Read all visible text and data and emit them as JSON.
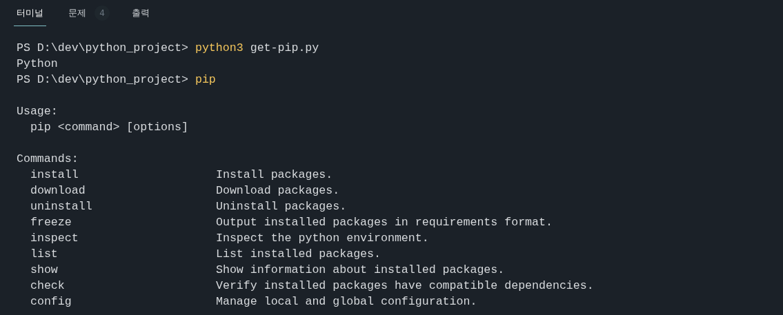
{
  "tabs": [
    {
      "label": "터미널",
      "selected": true
    },
    {
      "label": "문제",
      "selected": false,
      "badge": "4"
    },
    {
      "label": "출력",
      "selected": false
    }
  ],
  "terminal": {
    "lines": [
      {
        "kind": "prompt",
        "prompt": "PS D:\\dev\\python_project>",
        "command": "python3",
        "args": "get-pip.py"
      },
      {
        "kind": "output",
        "text": "Python"
      },
      {
        "kind": "prompt",
        "prompt": "PS D:\\dev\\python_project>",
        "command": "pip"
      },
      {
        "kind": "blank"
      },
      {
        "kind": "output",
        "text": "Usage:"
      },
      {
        "kind": "output",
        "text": "  pip <command> [options]"
      },
      {
        "kind": "blank"
      },
      {
        "kind": "output",
        "text": "Commands:"
      },
      {
        "kind": "entry",
        "name": "install",
        "description": "Install packages."
      },
      {
        "kind": "entry",
        "name": "download",
        "description": "Download packages."
      },
      {
        "kind": "entry",
        "name": "uninstall",
        "description": "Uninstall packages."
      },
      {
        "kind": "entry",
        "name": "freeze",
        "description": "Output installed packages in requirements format."
      },
      {
        "kind": "entry",
        "name": "inspect",
        "description": "Inspect the python environment."
      },
      {
        "kind": "entry",
        "name": "list",
        "description": "List installed packages."
      },
      {
        "kind": "entry",
        "name": "show",
        "description": "Show information about installed packages."
      },
      {
        "kind": "entry",
        "name": "check",
        "description": "Verify installed packages have compatible dependencies."
      },
      {
        "kind": "entry",
        "name": "config",
        "description": "Manage local and global configuration."
      }
    ]
  }
}
